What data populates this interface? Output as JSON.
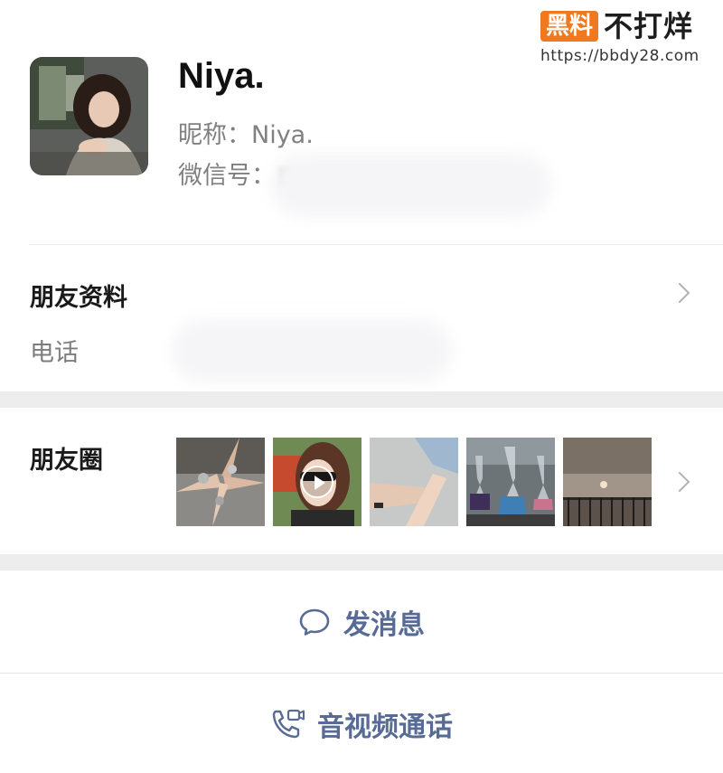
{
  "watermark": {
    "badge": "黑料",
    "title": "不打烊",
    "url": "https://bbdy28.com"
  },
  "profile": {
    "display_name": "Niya.",
    "nickname_line": "昵称：Niya.",
    "wechat_id_label": "微信号："
  },
  "friend_info": {
    "title": "朋友资料",
    "phone_label": "电话"
  },
  "moments": {
    "title": "朋友圈"
  },
  "actions": {
    "message_label": "发消息",
    "call_label": "音视频通话"
  },
  "colors": {
    "link_blue": "#576b95",
    "separator": "#ededed",
    "watermark_orange": "#f0781e"
  }
}
